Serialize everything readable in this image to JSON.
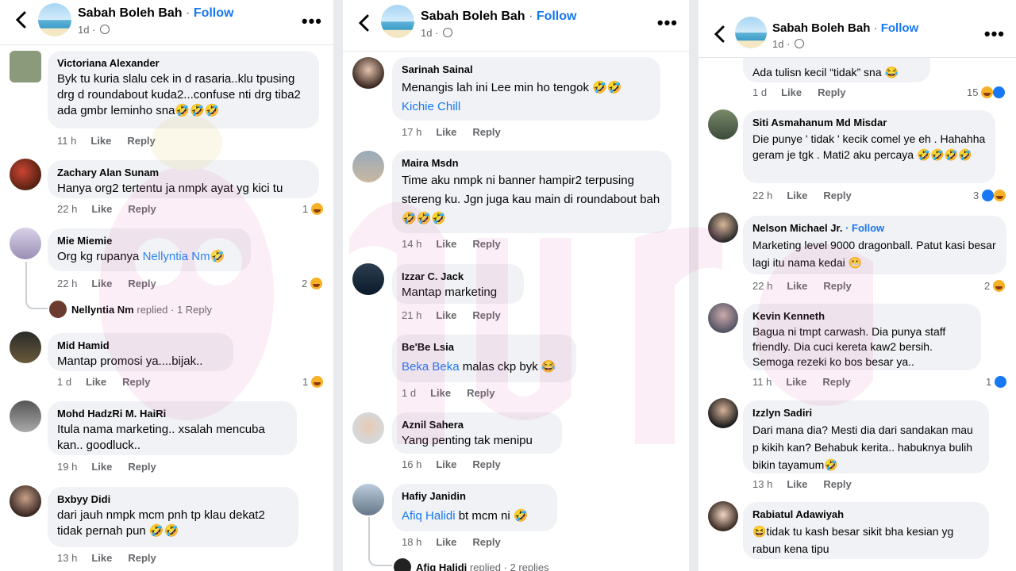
{
  "header": {
    "page_name": "Sabah Boleh Bah",
    "dot": "·",
    "follow": "Follow",
    "time": "1d",
    "more": "•••"
  },
  "panels": [
    {
      "comments": [
        {
          "name": "Victoriana Alexander",
          "text": "Byk tu kuria slalu cek in d rasaria..klu tpusing drg d roundabout kuda2...confuse nti drg tiba2 ada gmbr leminho sna🤣🤣🤣",
          "time": "11 h",
          "like": "Like",
          "reply": "Reply"
        },
        {
          "name": "Zachary Alan Sunam",
          "text": "Hanya org2 tertentu ja nmpk ayat yg kici tu",
          "time": "22 h",
          "like": "Like",
          "reply": "Reply",
          "reactions": "1"
        },
        {
          "name": "Mie Miemie",
          "text": "Org kg rupanya ",
          "mention": "Nellyntia Nm",
          "after": "🤣",
          "time": "22 h",
          "like": "Like",
          "reply": "Reply",
          "reactions": "2",
          "replied_name": "Nellyntia Nm",
          "replied_text": "replied · 1 Reply"
        },
        {
          "name": "Mid Hamid",
          "text": "Mantap promosi ya....bijak..",
          "time": "1 d",
          "like": "Like",
          "reply": "Reply",
          "reactions": "1"
        },
        {
          "name": "Mohd HadzRi M. HaiRi",
          "text": "Itula nama marketing.. xsalah mencuba kan.. goodluck..",
          "time": "19 h",
          "like": "Like",
          "reply": "Reply"
        },
        {
          "name": "Bxbyy Didi",
          "text": "dari jauh nmpk mcm pnh tp klau dekat2 tidak pernah pun 🤣🤣",
          "time": "13 h",
          "like": "Like",
          "reply": "Reply"
        }
      ]
    },
    {
      "comments": [
        {
          "name": "Sarinah Sainal",
          "text": "Menangis lah ini Lee min ho tengok 🤣🤣",
          "mention2": "Kichie Chill",
          "time": "17 h",
          "like": "Like",
          "reply": "Reply"
        },
        {
          "name": "Maira Msdn",
          "text": "Time aku nmpk ni banner hampir2 terpusing stereng ku. Jgn juga kau main di roundabout bah 🤣🤣🤣",
          "time": "14 h",
          "like": "Like",
          "reply": "Reply"
        },
        {
          "name": "Izzar C. Jack",
          "text": "Mantap marketing",
          "time": "21 h",
          "like": "Like",
          "reply": "Reply"
        },
        {
          "name": "Be'Be Lsia",
          "mention": "Beka Beka",
          "text": " malas ckp byk 😂",
          "time": "1 d",
          "like": "Like",
          "reply": "Reply"
        },
        {
          "name": "Aznil Sahera",
          "text": "Yang penting tak menipu",
          "time": "16 h",
          "like": "Like",
          "reply": "Reply"
        },
        {
          "name": "Hafiy Janidin",
          "mention": "Afiq Halidi",
          "text": " bt mcm ni 🤣",
          "time": "18 h",
          "like": "Like",
          "reply": "Reply",
          "replied_name": "Afiq Halidi",
          "replied_text": "replied · 2 replies"
        }
      ]
    },
    {
      "comments": [
        {
          "text": "Ada tulisn kecil “tidak” sna 😂",
          "time": "1 d",
          "like": "Like",
          "reply": "Reply",
          "reactions": "15"
        },
        {
          "name": "Siti Asmahanum Md Misdar",
          "text": "Die punye ' tidak ' kecik comel ye eh . Hahahha geram je tgk . Mati2 aku percaya 🤣🤣🤣🤣",
          "time": "22 h",
          "like": "Like",
          "reply": "Reply",
          "reactions": "3"
        },
        {
          "name": "Nelson Michael Jr.",
          "follow": "· Follow",
          "text": "Marketing level 9000 dragonball. Patut kasi besar lagi itu nama kedai 😬",
          "time": "22 h",
          "like": "Like",
          "reply": "Reply",
          "reactions": "2"
        },
        {
          "name": "Kevin Kenneth",
          "text": "Bagua ni tmpt carwash. Dia punya staff friendly. Dia cuci kereta kaw2 bersih. Semoga rezeki ko bos besar ya..",
          "time": "11 h",
          "like": "Like",
          "reply": "Reply",
          "reactions": "1"
        },
        {
          "name": "Izzlyn Sadiri",
          "text": "Dari mana dia? Mesti dia dari sandakan mau p kikih kan? Behabuk kerita.. habuknya bulih bikin tayamum🤣",
          "time": "13 h",
          "like": "Like",
          "reply": "Reply"
        },
        {
          "name": "Rabiatul Adawiyah",
          "text": "😆tidak tu kash besar sikit bha kesian yg rabun kena tipu"
        }
      ]
    }
  ],
  "colors": {
    "link": "#1877f2",
    "bubble": "#f0f2f5",
    "meta": "#65676b",
    "text": "#050505"
  }
}
